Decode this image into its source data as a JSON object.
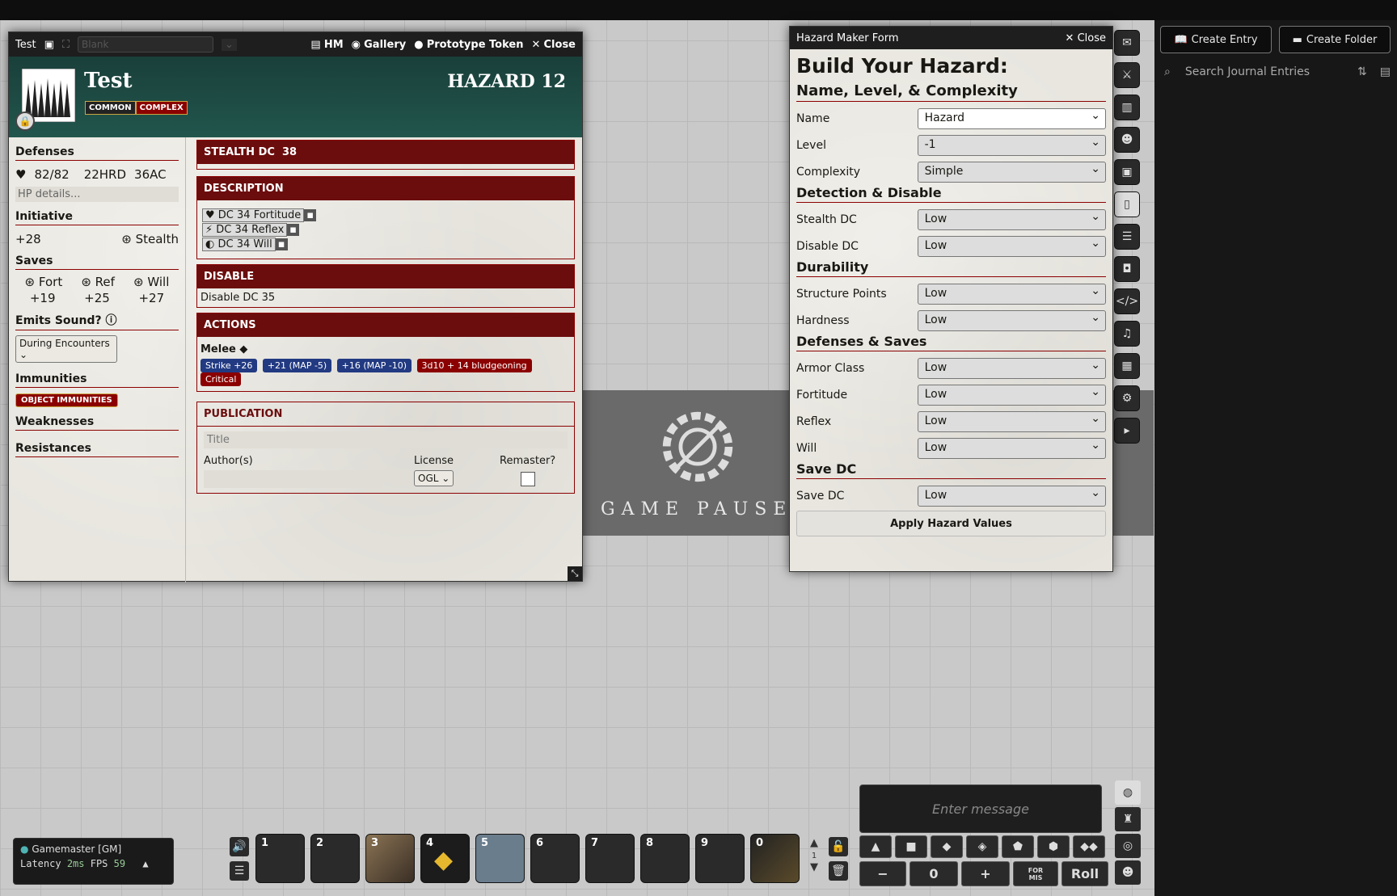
{
  "paused": "GAME PAUSED",
  "sidebar": {
    "create_entry": "Create Entry",
    "create_folder": "Create Folder",
    "search_placeholder": "Search Journal Entries"
  },
  "sheet": {
    "window_title": "Test",
    "sheet_select": "Blank",
    "header_buttons": {
      "hm": "HM",
      "gallery": "Gallery",
      "prototype": "Prototype Token",
      "close": "Close"
    },
    "name": "Test",
    "level": "HAZARD 12",
    "traits": [
      "COMMON",
      "COMPLEX"
    ],
    "defenses": {
      "heading": "Defenses",
      "hp": "82/82",
      "hardness": "22",
      "hardness_label": "HRD",
      "ac": "36",
      "ac_label": "AC",
      "hp_details": "HP details..."
    },
    "initiative": {
      "heading": "Initiative",
      "value": "+28",
      "skill": "Stealth"
    },
    "saves": {
      "heading": "Saves",
      "fort_label": "Fort",
      "ref_label": "Ref",
      "will_label": "Will",
      "fort": "+19",
      "ref": "+25",
      "will": "+27"
    },
    "emits": {
      "heading": "Emits Sound?",
      "value": "During Encounters"
    },
    "immunities": {
      "heading": "Immunities",
      "tag": "OBJECT IMMUNITIES"
    },
    "weaknesses": "Weaknesses",
    "resistances": "Resistances",
    "stealth": {
      "label": "STEALTH DC",
      "value": "38"
    },
    "description": {
      "heading": "DESCRIPTION",
      "checks": [
        "DC 34 Fortitude",
        "DC 34 Reflex",
        "DC 34 Will"
      ]
    },
    "disable": {
      "heading": "DISABLE",
      "text": "Disable DC 35"
    },
    "actions": {
      "heading": "ACTIONS",
      "melee": "Melee",
      "strike": "Strike +26",
      "map5": "+21 (MAP -5)",
      "map10": "+16 (MAP -10)",
      "damage": "3d10 + 14 bludgeoning",
      "critical": "Critical"
    },
    "publication": {
      "heading": "PUBLICATION",
      "title_placeholder": "Title",
      "authors": "Author(s)",
      "license": "License",
      "license_value": "OGL",
      "remaster": "Remaster?"
    }
  },
  "form": {
    "window_title": "Hazard Maker Form",
    "close": "Close",
    "title": "Build Your Hazard:",
    "s1": "Name, Level, & Complexity",
    "name_label": "Name",
    "name_value": "Hazard",
    "level_label": "Level",
    "level_value": "-1",
    "complexity_label": "Complexity",
    "complexity_value": "Simple",
    "s2": "Detection & Disable",
    "stealth_label": "Stealth DC",
    "stealth_value": "Low",
    "disable_label": "Disable DC",
    "disable_value": "Low",
    "s3": "Durability",
    "sp_label": "Structure Points",
    "sp_value": "Low",
    "hardness_label": "Hardness",
    "hardness_value": "Low",
    "s4": "Defenses & Saves",
    "ac_label": "Armor Class",
    "ac_value": "Low",
    "fort_label": "Fortitude",
    "fort_value": "Low",
    "ref_label": "Reflex",
    "ref_value": "Low",
    "will_label": "Will",
    "will_value": "Low",
    "s5": "Save DC",
    "savedc_label": "Save DC",
    "savedc_value": "Low",
    "apply": "Apply Hazard Values"
  },
  "players": {
    "name": "Gamemaster [GM]",
    "latency_label": "Latency",
    "latency": "2ms",
    "fps_label": "FPS",
    "fps": "59"
  },
  "hotbar": {
    "slots": [
      "1",
      "2",
      "3",
      "4",
      "5",
      "6",
      "7",
      "8",
      "9",
      "0"
    ],
    "page": "1"
  },
  "chat": {
    "placeholder": "Enter message"
  },
  "roll": {
    "minus": "−",
    "value": "0",
    "plus": "+",
    "formis": "FOR",
    "formis2": "MIS",
    "roll": "Roll"
  }
}
